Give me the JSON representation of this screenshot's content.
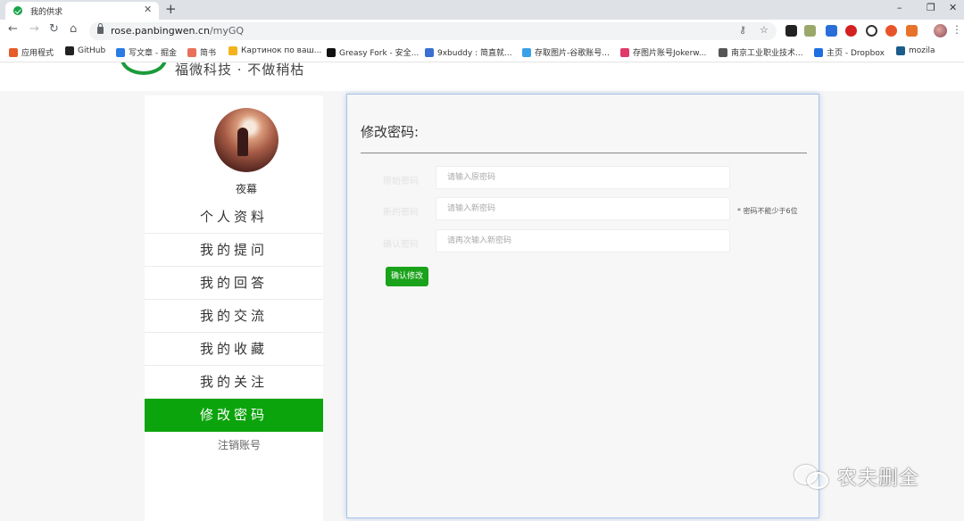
{
  "browser": {
    "tab_title": "我的供求",
    "url_host": "rose.panbingwen.cn",
    "url_path": "/myGQ",
    "bookmarks": [
      {
        "label": "应用程式",
        "color": "#e65c2a"
      },
      {
        "label": "GitHub",
        "color": "#222222"
      },
      {
        "label": "写文章 - 掘金",
        "color": "#2a7be4"
      },
      {
        "label": "简书",
        "color": "#e8715a"
      },
      {
        "label": "Картинок по ваш...",
        "color": "#f2b31c"
      },
      {
        "label": "Greasy Fork - 安全...",
        "color": "#111111"
      },
      {
        "label": "9xbuddy : 简直就...",
        "color": "#3b6fd1"
      },
      {
        "label": "存取图片-谷歌账号...",
        "color": "#3aa0e8"
      },
      {
        "label": "存图片账号Jokerw...",
        "color": "#e03a6a"
      },
      {
        "label": "南京工业职业技术...",
        "color": "#555555"
      },
      {
        "label": "主页 - Dropbox",
        "color": "#1f6fe0"
      },
      {
        "label": "mozila",
        "color": "#1b5c8a"
      }
    ]
  },
  "site": {
    "logo_text": "福微科技 · 不做稍枯"
  },
  "sidebar": {
    "username": "夜幕",
    "menu": [
      {
        "label": "个人资料",
        "active": false
      },
      {
        "label": "我的提问",
        "active": false
      },
      {
        "label": "我的回答",
        "active": false
      },
      {
        "label": "我的交流",
        "active": false
      },
      {
        "label": "我的收藏",
        "active": false
      },
      {
        "label": "我的关注",
        "active": false
      },
      {
        "label": "修改密码",
        "active": true
      }
    ],
    "footer_link": "注销账号"
  },
  "form": {
    "title": "修改密码:",
    "fields": [
      {
        "label": "原始密码",
        "placeholder": "请输入原密码"
      },
      {
        "label": "新的密码",
        "placeholder": "请输入新密码"
      },
      {
        "label": "确认密码",
        "placeholder": "请再次输入新密码"
      }
    ],
    "hint": "* 密码不能少于6位",
    "submit_label": "确认修改"
  },
  "watermark": {
    "text": "农夫删全"
  },
  "icons": {
    "back": "back-arrow-icon",
    "forward": "forward-arrow-icon",
    "reload": "reload-icon",
    "home": "home-icon",
    "lock": "lock-icon",
    "key": "key-icon",
    "star": "star-icon"
  }
}
